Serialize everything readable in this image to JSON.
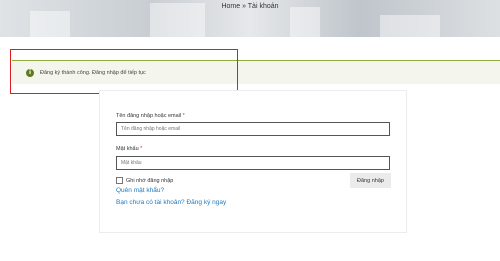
{
  "banner": {
    "breadcrumb": "Home » Tài khoản"
  },
  "notice": {
    "icon": "info-icon",
    "message": "Đăng ký thành công. Đăng nhập để tiếp tục"
  },
  "form": {
    "username_label": "Tên đăng nhập hoặc email",
    "username_required": "*",
    "username_placeholder": "Tên đăng nhập hoặc email",
    "password_label": "Mật khẩu",
    "password_required": "*",
    "password_placeholder": "Mật khẩu",
    "remember_label": "Ghi nhớ đăng nhập",
    "login_button": "Đăng nhập",
    "forgot_password": "Quên mật khẩu?",
    "register_link": "Bạn chưa có tài khoản? Đăng ký ngay"
  },
  "colors": {
    "accent": "#8fae3b",
    "link": "#1e7bbf",
    "highlight": "#e01c24"
  }
}
